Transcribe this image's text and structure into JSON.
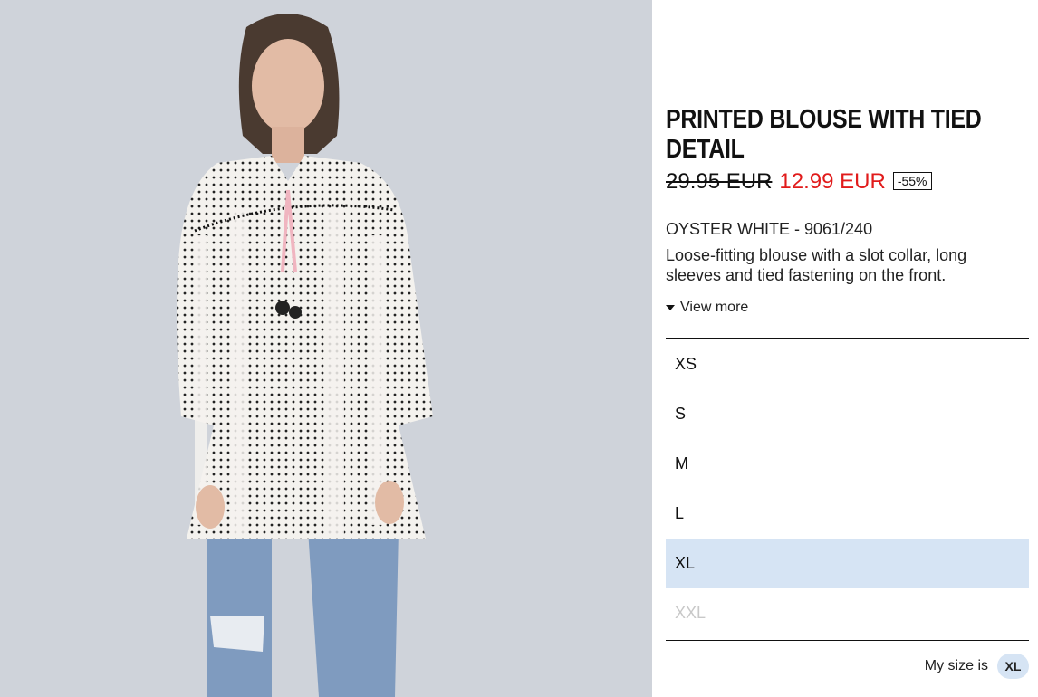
{
  "product": {
    "image_alt": "Model wearing printed blouse with tied detail",
    "title": "PRINTED BLOUSE WITH TIED DETAIL",
    "old_price": "29.95 EUR",
    "new_price": "12.99 EUR",
    "discount": "-55%",
    "color_ref": "OYSTER WHITE - 9061/240",
    "description": "Loose-fitting blouse with a slot collar, long sleeves and tied fastening on the front.",
    "view_more": "View more"
  },
  "sizes": [
    {
      "label": "XS",
      "state": "normal"
    },
    {
      "label": "S",
      "state": "normal"
    },
    {
      "label": "M",
      "state": "normal"
    },
    {
      "label": "L",
      "state": "normal"
    },
    {
      "label": "XL",
      "state": "selected"
    },
    {
      "label": "XXL",
      "state": "disabled"
    }
  ],
  "my_size": {
    "label": "My size is",
    "value": "XL"
  },
  "colors": {
    "sale": "#e11b1b",
    "selected_bg": "#d6e4f4",
    "disabled_text": "#c8c8c8",
    "photo_bg": "#cfd3da"
  }
}
